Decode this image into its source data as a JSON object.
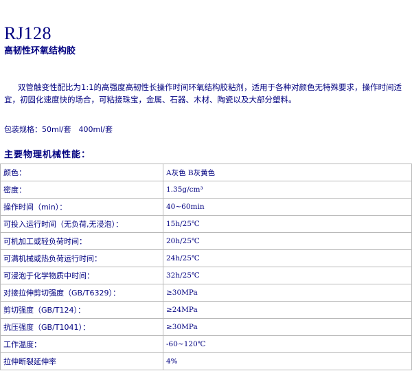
{
  "product": {
    "code": "RJ128",
    "name": "高韧性环氧结构胶"
  },
  "description": "双管触变性配比为1:1的高强度高韧性长操作时间环氧结构胶粘剂，适用于各种对颜色无特殊要求，操作时间适宜，初固化速度快的场合，可粘接珠宝，金属、石器、木材、陶瓷以及大部分塑料。",
  "packaging": "包装规格：50ml/套　400ml/套",
  "properties": {
    "heading": "主要物理机械性能：",
    "rows": [
      {
        "label": "颜色：",
        "value": "A灰色 B灰黄色"
      },
      {
        "label": "密度：",
        "value": "1.35g/cm³"
      },
      {
        "label": "操作时间（min）：",
        "value": "40~60min"
      },
      {
        "label": "可投入运行时间（无负荷,无浸泡）：",
        "value": "15h/25℃"
      },
      {
        "label": "可机加工或轻负荷时间：",
        "value": "20h/25℃"
      },
      {
        "label": "可满机械或热负荷运行时间：",
        "value": "24h/25℃"
      },
      {
        "label": "可浸泡于化学物质中时间：",
        "value": "32h/25℃"
      },
      {
        "label": "对接拉伸剪切强度（GB/T6329）：",
        "value": "≥30MPa"
      },
      {
        "label": "剪切强度（GB/T124）：",
        "value": "≥24MPa"
      },
      {
        "label": "抗压强度（GB/T1041）：",
        "value": "≥30MPa"
      },
      {
        "label": "工作温度：",
        "value": "-60~120℃"
      },
      {
        "label": "拉伸断裂延伸率",
        "value": "4%"
      }
    ]
  }
}
